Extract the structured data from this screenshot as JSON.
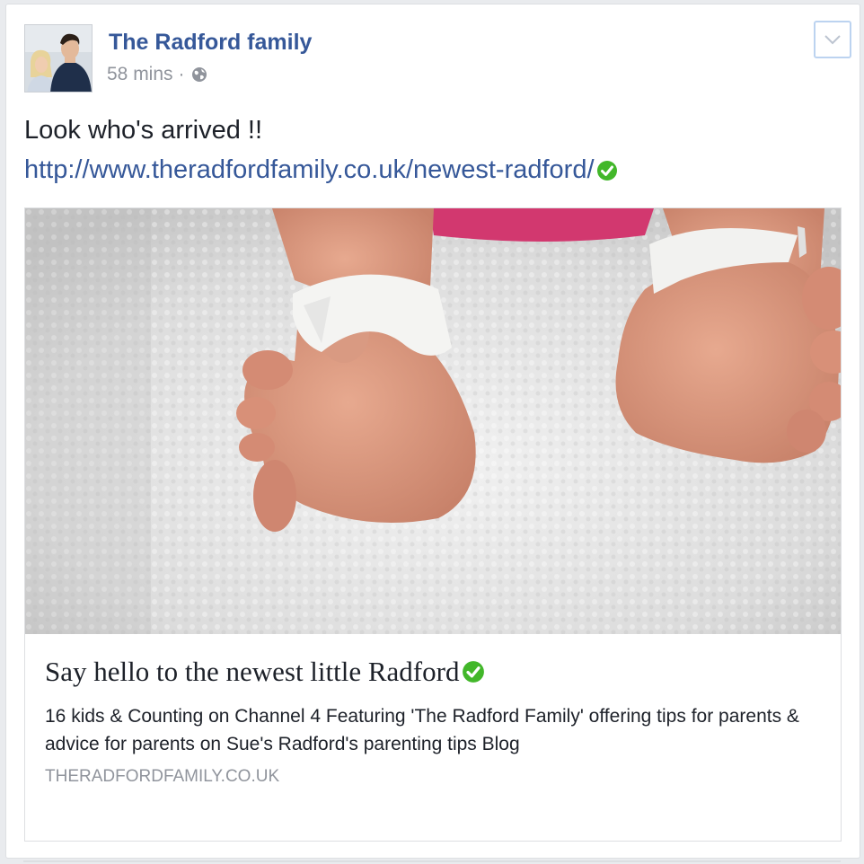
{
  "post": {
    "author": "The Radford family",
    "time": "58 mins",
    "separator": "·",
    "privacy_icon": "globe-icon",
    "options_icon": "chevron-down-icon",
    "text": "Look who's arrived !!",
    "link": "http://www.theradfordfamily.co.uk/newest-radford/",
    "verified_icon": "green-check-icon"
  },
  "card": {
    "image_description_icon": "baby-feet-photo",
    "title": "Say hello to the newest little Radford",
    "description": "16 kids & Counting on Channel 4 Featuring 'The Radford Family' offering tips for parents & advice for parents on Sue's Radford's parenting tips Blog",
    "domain": "THERADFORDFAMILY.CO.UK"
  },
  "colors": {
    "link": "#365899",
    "meta": "#90949c",
    "check": "#42b72a"
  }
}
